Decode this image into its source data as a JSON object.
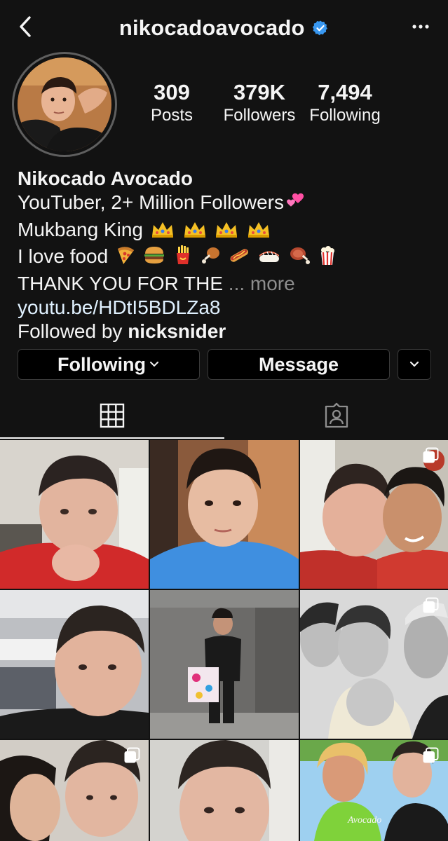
{
  "header": {
    "username": "nikocadoavocado",
    "verified": true,
    "back_icon": "chevron-left-icon",
    "more_icon": "more-horizontal-icon"
  },
  "stats": [
    {
      "value": "309",
      "label": "Posts"
    },
    {
      "value": "379K",
      "label": "Followers"
    },
    {
      "value": "7,494",
      "label": "Following"
    }
  ],
  "bio": {
    "name": "Nikocado Avocado",
    "line1": "YouTuber, 2+ Million Followers",
    "line1_emoji": "two-hearts",
    "line2": "Mukbang King",
    "line2_emojis": [
      "crown",
      "crown",
      "crown",
      "crown"
    ],
    "line3": "I love food",
    "line3_emojis": [
      "pizza",
      "hamburger",
      "fries",
      "poultry-leg",
      "hot-dog",
      "sushi",
      "meat-on-bone",
      "popcorn"
    ],
    "line4": "THANK YOU FOR THE",
    "more_label": "... more",
    "link": "youtu.be/HDtI5BDLZa8",
    "followed_by_prefix": "Followed by ",
    "followed_by_user": "nicksnider"
  },
  "actions": {
    "following_label": "Following",
    "message_label": "Message"
  },
  "tabs": [
    {
      "icon": "grid-icon",
      "active": true
    },
    {
      "icon": "tagged-icon",
      "active": false
    }
  ],
  "posts": [
    {
      "subject": "selfie-red-shirt",
      "multiple": false
    },
    {
      "subject": "selfie-blue-shirt",
      "multiple": false
    },
    {
      "subject": "selfie-with-friend",
      "multiple": true
    },
    {
      "subject": "airport-selfie",
      "multiple": false
    },
    {
      "subject": "elevator-mirror-selfie",
      "multiple": false
    },
    {
      "subject": "black-and-white-group",
      "multiple": true
    },
    {
      "subject": "selfie-with-woman",
      "multiple": true
    },
    {
      "subject": "closeup-selfie",
      "multiple": false
    },
    {
      "subject": "avocado-slut-shirt",
      "multiple": true
    }
  ],
  "colors": {
    "background": "#121212",
    "text": "#f5f5f5",
    "secondary_text": "#8e8e8e",
    "link": "#e0f1ff",
    "verified": "#3897f0",
    "button_border": "#3a3a3a"
  }
}
